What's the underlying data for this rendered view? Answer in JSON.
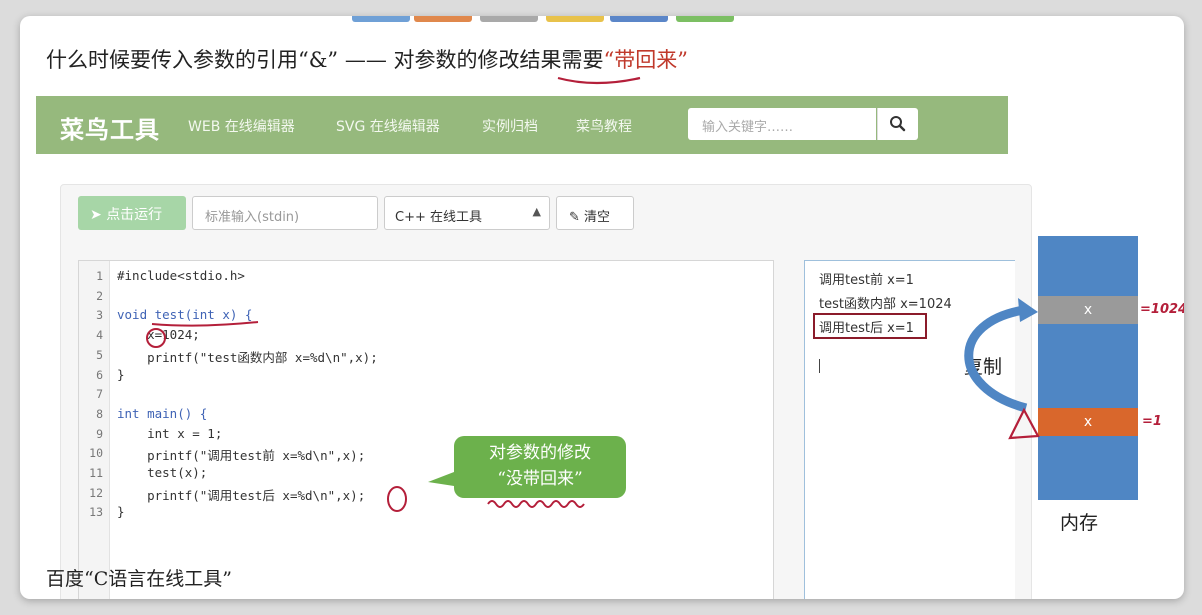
{
  "colors": {
    "nav_green": "#96b97d",
    "run_green": "#a7d6a7",
    "memory_blue": "#4f86c4",
    "cell_gray": "#9a9a9a",
    "cell_orange": "#d9672c",
    "annotation_red": "#b41f3a"
  },
  "slide": {
    "caption_prefix": "什么时候要传入参数的引用“&” —— 对参数的修改结果需要",
    "caption_emphasis": "“带回来”",
    "bottom_caption": "百度“C语言在线工具”"
  },
  "navbar": {
    "logo": "菜鸟工具",
    "links": [
      "WEB 在线编辑器",
      "SVG 在线编辑器",
      "实例归档",
      "菜鸟教程"
    ],
    "search_placeholder": "输入关键字……",
    "search_icon": "search-icon"
  },
  "toolbar": {
    "run_label": "点击运行",
    "run_icon": "paper-plane-icon",
    "stdin_placeholder": "标准输入(stdin)",
    "language_selected": "C++ 在线工具",
    "clear_label": "清空",
    "clear_icon": "eraser-icon"
  },
  "editor": {
    "lines": [
      "#include<stdio.h>",
      "",
      "void test(int x) {",
      "    x=1024;",
      "    printf(\"test函数内部 x=%d\\n\",x);",
      "}",
      "",
      "int main() {",
      "    int x = 1;",
      "    printf(\"调用test前 x=%d\\n\",x);",
      "    test(x);",
      "    printf(\"调用test后 x=%d\\n\",x);",
      "}"
    ],
    "line_numbers": [
      "1",
      "2",
      "3",
      "4",
      "5",
      "6",
      "7",
      "8",
      "9",
      "10",
      "11",
      "12",
      "13"
    ]
  },
  "output": {
    "lines": [
      "调用test前 x=1",
      "test函数内部 x=1024",
      "调用test后 x=1"
    ]
  },
  "annotations": {
    "bubble_line1": "对参数的修改",
    "bubble_line2": "“没带回来”",
    "copy_label": "复制",
    "memory_label": "内存",
    "cell_top_label": "x",
    "cell_bottom_label": "x",
    "value_top": "=1024",
    "value_bottom": "=1"
  }
}
